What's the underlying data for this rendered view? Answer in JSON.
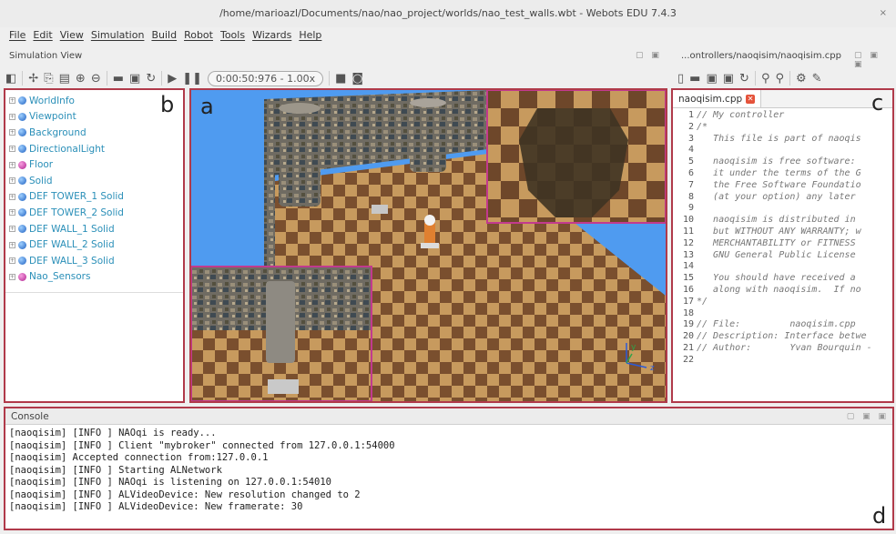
{
  "window": {
    "title": "/home/marioazl/Documents/nao/nao_project/worlds/nao_test_walls.wbt - Webots EDU 7.4.3",
    "close_glyph": "×"
  },
  "menu": [
    "File",
    "Edit",
    "View",
    "Simulation",
    "Build",
    "Robot",
    "Tools",
    "Wizards",
    "Help"
  ],
  "simulation_view": {
    "title": "Simulation View",
    "time_display": "0:00:50:976  -  1.00x",
    "label": "a"
  },
  "scene_tree": {
    "label": "b",
    "items": [
      {
        "name": "WorldInfo",
        "color": "blue"
      },
      {
        "name": "Viewpoint",
        "color": "blue"
      },
      {
        "name": "Background",
        "color": "blue"
      },
      {
        "name": "DirectionalLight",
        "color": "blue"
      },
      {
        "name": "Floor",
        "color": "pink"
      },
      {
        "name": "Solid",
        "color": "blue"
      },
      {
        "name": "DEF TOWER_1 Solid",
        "color": "blue"
      },
      {
        "name": "DEF TOWER_2 Solid",
        "color": "blue"
      },
      {
        "name": "DEF WALL_1 Solid",
        "color": "blue"
      },
      {
        "name": "DEF WALL_2 Solid",
        "color": "blue"
      },
      {
        "name": "DEF WALL_3 Solid",
        "color": "blue"
      },
      {
        "name": "Nao_Sensors",
        "color": "pink"
      }
    ]
  },
  "editor": {
    "path": "...ontrollers/naoqisim/naoqisim.cpp",
    "tab_label": "naoqisim.cpp",
    "label": "c",
    "lines": [
      {
        "n": "1",
        "t": "// My controller"
      },
      {
        "n": "2",
        "t": "/*"
      },
      {
        "n": "3",
        "t": "   This file is part of naoqis"
      },
      {
        "n": "4",
        "t": ""
      },
      {
        "n": "5",
        "t": "   naoqisim is free software: "
      },
      {
        "n": "6",
        "t": "   it under the terms of the G"
      },
      {
        "n": "7",
        "t": "   the Free Software Foundatio"
      },
      {
        "n": "8",
        "t": "   (at your option) any later "
      },
      {
        "n": "9",
        "t": ""
      },
      {
        "n": "10",
        "t": "   naoqisim is distributed in "
      },
      {
        "n": "11",
        "t": "   but WITHOUT ANY WARRANTY; w"
      },
      {
        "n": "12",
        "t": "   MERCHANTABILITY or FITNESS "
      },
      {
        "n": "13",
        "t": "   GNU General Public License "
      },
      {
        "n": "14",
        "t": ""
      },
      {
        "n": "15",
        "t": "   You should have received a "
      },
      {
        "n": "16",
        "t": "   along with naoqisim.  If no"
      },
      {
        "n": "17",
        "t": "*/"
      },
      {
        "n": "18",
        "t": ""
      },
      {
        "n": "19",
        "t": "// File:         naoqisim.cpp"
      },
      {
        "n": "20",
        "t": "// Description: Interface betwe"
      },
      {
        "n": "21",
        "t": "// Author:       Yvan Bourquin -"
      },
      {
        "n": "22",
        "t": ""
      }
    ]
  },
  "console": {
    "title": "Console",
    "label": "d",
    "lines": [
      "[naoqisim] [INFO ] NAOqi is ready...",
      "[naoqisim] [INFO ] Client \"mybroker\" connected from 127.0.0.1:54000",
      "[naoqisim] Accepted connection from:127.0.0.1",
      "[naoqisim] [INFO ] Starting ALNetwork",
      "[naoqisim] [INFO ] NAOqi is listening on 127.0.0.1:54010",
      "[naoqisim] [INFO ] ALVideoDevice: New resolution changed to 2",
      "[naoqisim] [INFO ] ALVideoDevice: New framerate: 30"
    ]
  },
  "axes": {
    "y": "y",
    "z": "z"
  },
  "icons": {
    "toolbar": [
      "panel-icon",
      "add-node-icon",
      "copy-icon",
      "paste-icon",
      "add-icon",
      "remove-icon",
      "open-folder-icon",
      "save-icon",
      "reload-icon",
      "run-icon",
      "pause-icon",
      "record-icon",
      "screenshot-icon"
    ],
    "editor_toolbar": [
      "new-file-icon",
      "open-icon",
      "save-icon",
      "save-as-icon",
      "revert-icon",
      "find-icon",
      "replace-icon",
      "build-icon",
      "clean-icon"
    ]
  },
  "colors": {
    "panel_border": "#b03a4a",
    "sky": "#4f9bf0",
    "tree_text": "#2a8fb8"
  }
}
